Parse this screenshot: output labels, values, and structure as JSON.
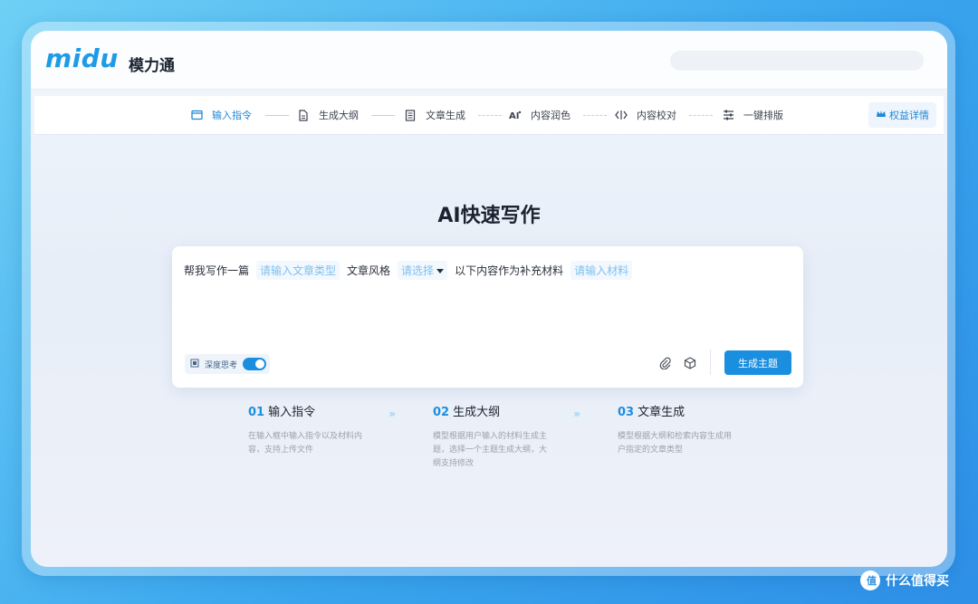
{
  "app": {
    "logo_text": "midu",
    "logo_cn": "模力通"
  },
  "steps": [
    {
      "label": "输入指令",
      "icon": "window-icon",
      "active": true
    },
    {
      "label": "生成大纲",
      "icon": "document-icon",
      "active": false
    },
    {
      "label": "文章生成",
      "icon": "article-icon",
      "active": false
    },
    {
      "label": "内容润色",
      "icon": "ai-polish-icon",
      "active": false
    },
    {
      "label": "内容校对",
      "icon": "compare-icon",
      "active": false
    },
    {
      "label": "一键排版",
      "icon": "layout-icon",
      "active": false
    }
  ],
  "rights_label": "权益详情",
  "main": {
    "title": "AI快速写作",
    "prompt": {
      "prefix": "帮我写作一篇",
      "type_placeholder": "请输入文章类型",
      "style_label": "文章风格",
      "style_select": "请选择",
      "material_label": "以下内容作为补充材料",
      "material_placeholder": "请输入材料"
    },
    "deep_think_label": "深度思考",
    "deep_think_on": true,
    "generate_label": "生成主题"
  },
  "guide": [
    {
      "num": "01",
      "title": "输入指令",
      "desc": "在输入框中输入指令以及材料内容，支持上传文件"
    },
    {
      "num": "02",
      "title": "生成大纲",
      "desc": "模型根据用户输入的材料生成主题，选择一个主题生成大纲，大纲支持修改"
    },
    {
      "num": "03",
      "title": "文章生成",
      "desc": "模型根据大纲和检索内容生成用户指定的文章类型"
    }
  ],
  "watermark": "什么值得买",
  "colors": {
    "accent": "#1a8fe0",
    "placeholder": "#7ec0ef",
    "background": "#3aa6ee"
  }
}
